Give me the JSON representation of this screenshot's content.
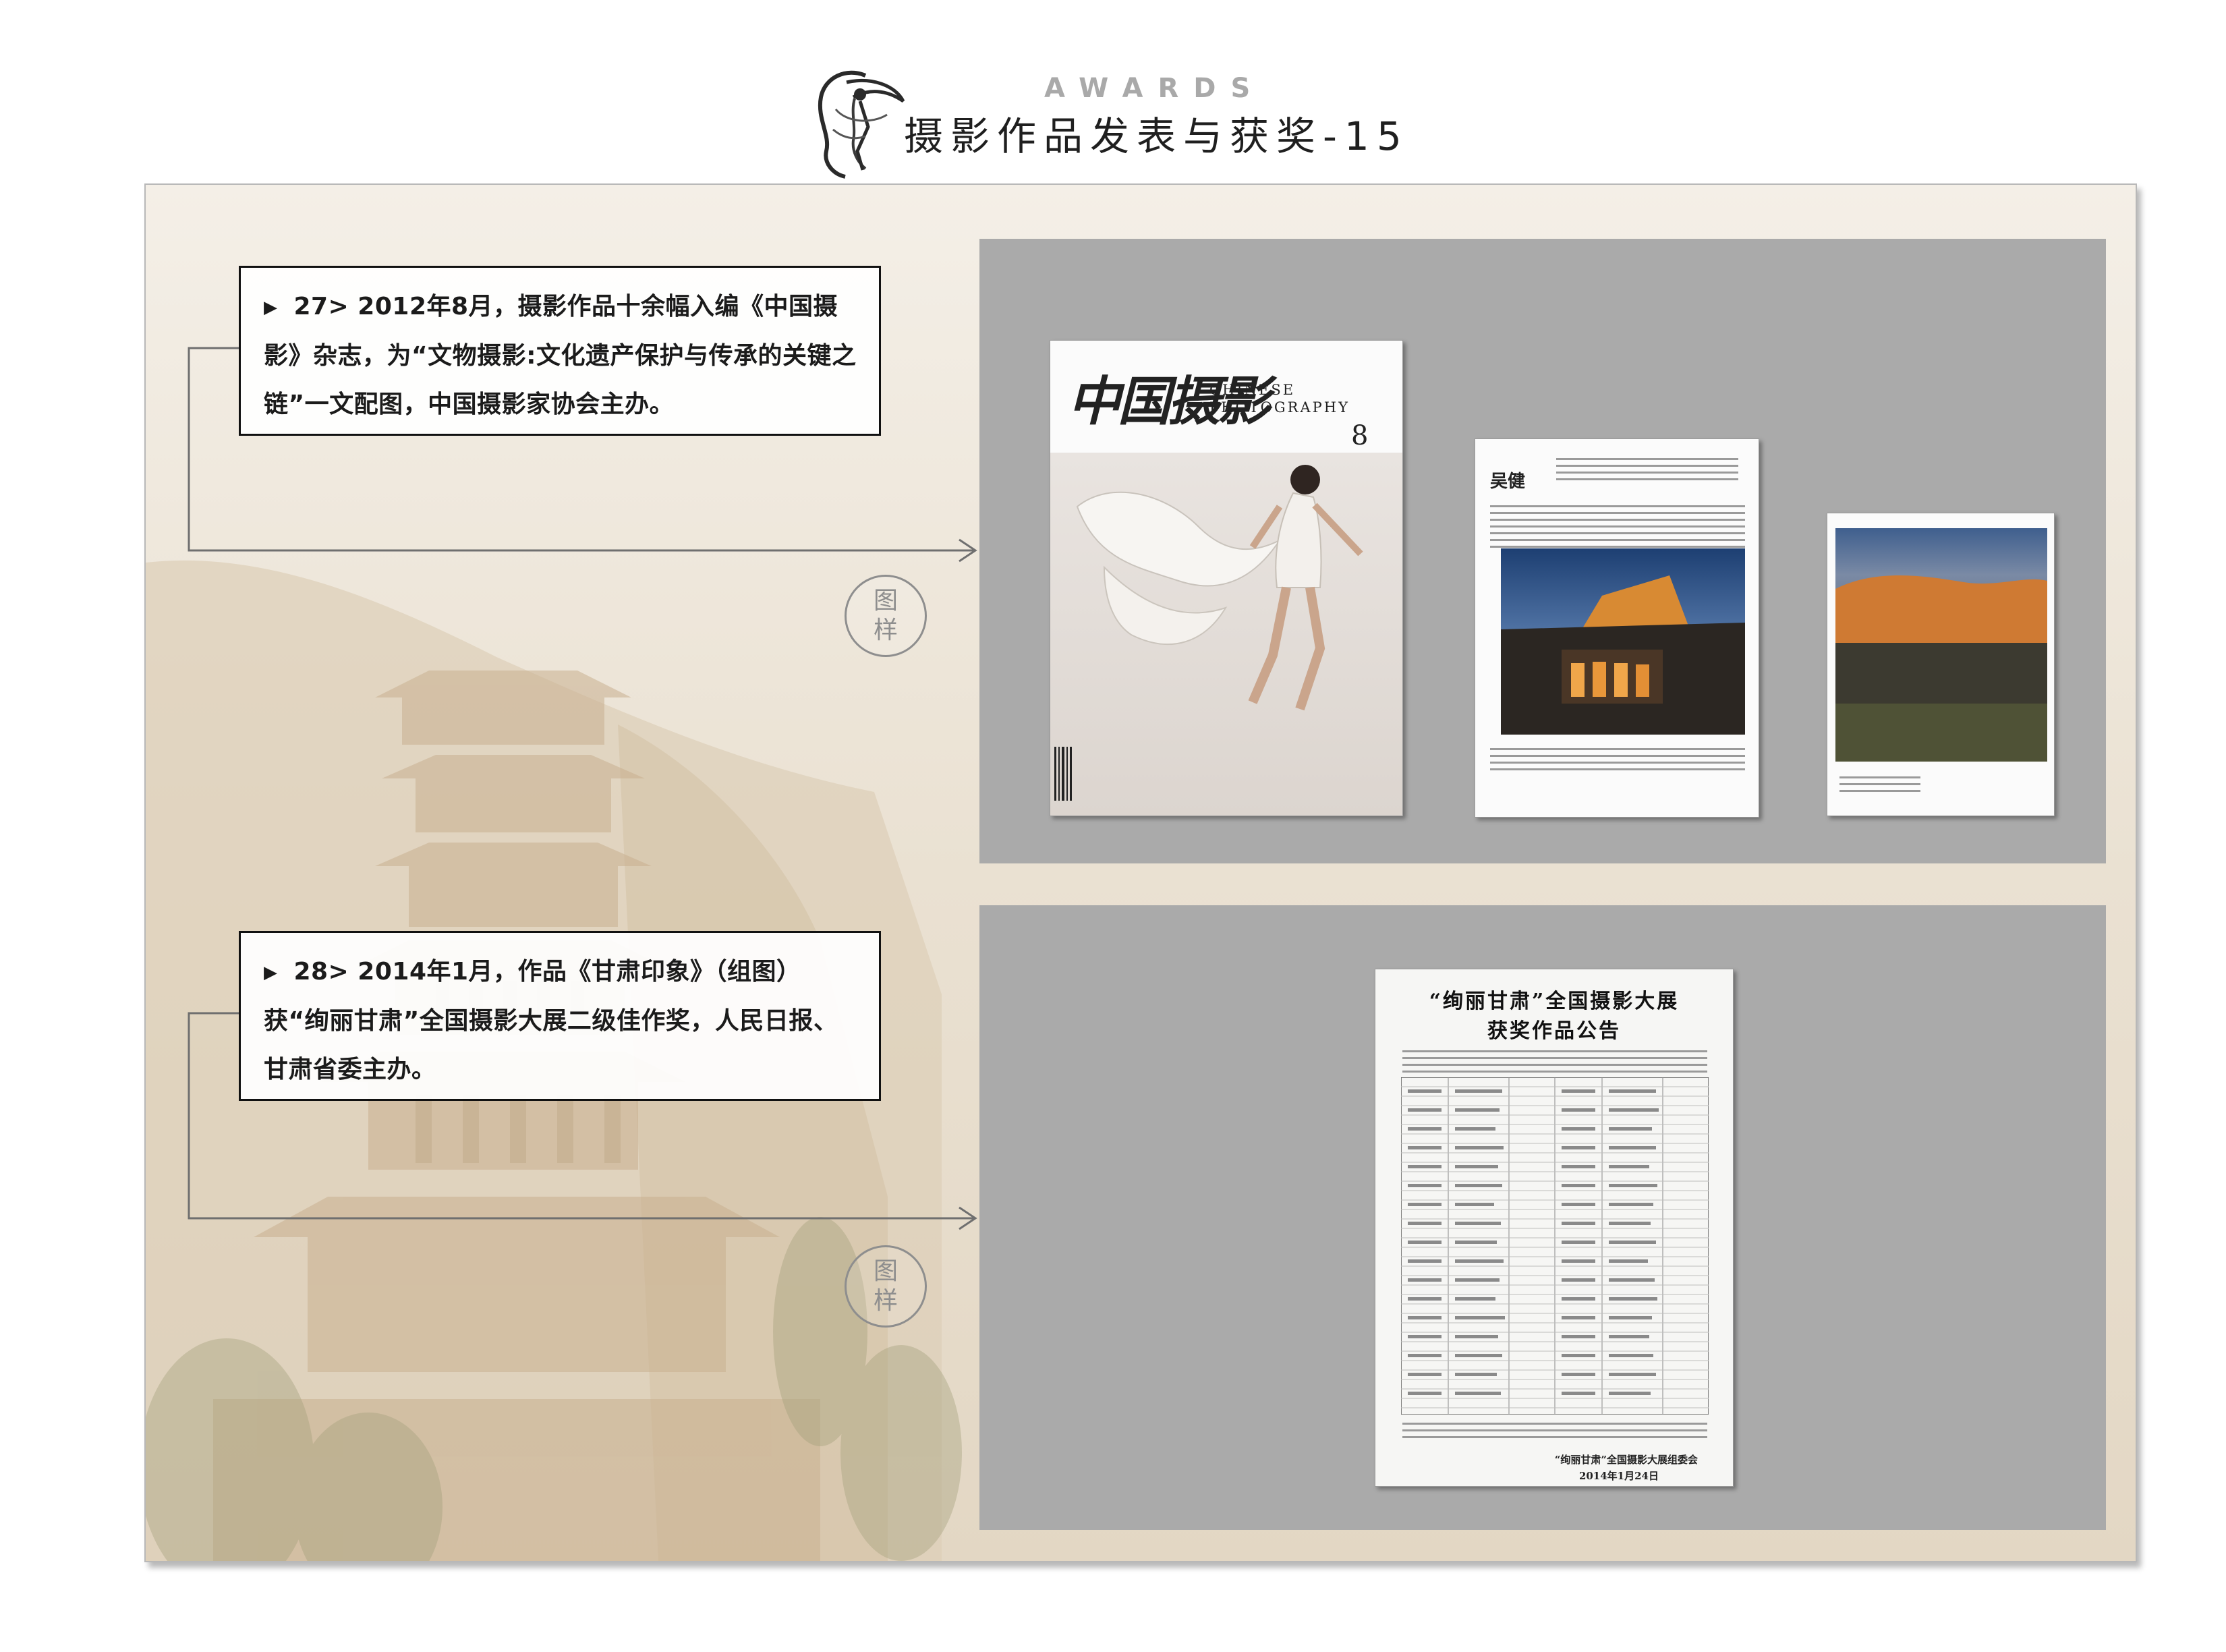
{
  "header": {
    "awards_label": "AWARDS",
    "title": "摄影作品发表与获奖-15"
  },
  "entries": [
    {
      "bullet_icon": "triangle-right-icon",
      "text": "27> 2012年8月，摄影作品十余幅入编《中国摄影》杂志，为“文物摄影:文化遗产保护与传承的关键之链”一文配图，中国摄影家协会主办。",
      "stamp": [
        "图",
        "样"
      ]
    },
    {
      "bullet_icon": "triangle-right-icon",
      "text": "28> 2014年1月，作品《甘肃印象》（组图）获“绚丽甘肃”全国摄影大展二级佳作奖，人民日报、甘肃省委主办。",
      "stamp": [
        "图",
        "样"
      ]
    }
  ],
  "magazine": {
    "cover_title": "中国摄影",
    "cover_english_1": "CHINESE",
    "cover_english_2": "PHOTOGRAPHY",
    "issue": "8",
    "article_author": "吴健"
  },
  "newspaper": {
    "title_line1": "“绚丽甘肃”全国摄影大展",
    "title_line2": "获奖作品公告",
    "signature": "“绚丽甘肃”全国摄影大展组委会",
    "date": "2014年1月24日"
  },
  "colors": {
    "panel_grey": "#aaaaaa",
    "box_border": "#111111",
    "awards_grey": "#a9a9a9"
  }
}
